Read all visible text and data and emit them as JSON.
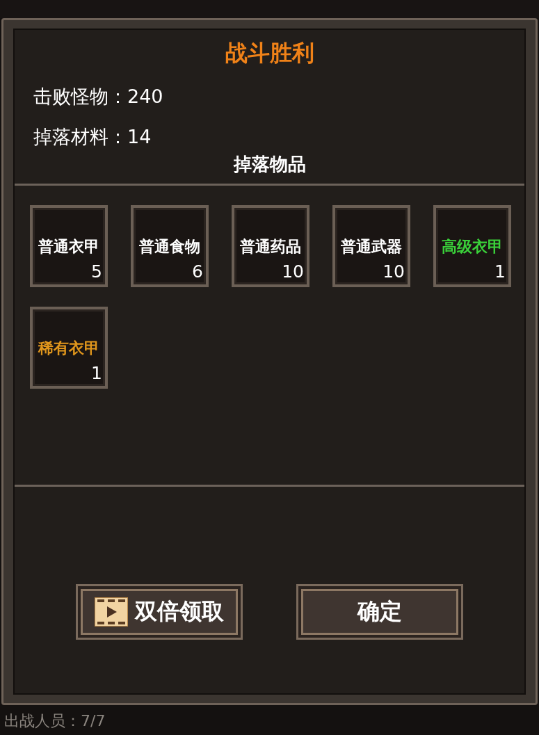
{
  "title": "战斗胜利",
  "stats": [
    {
      "label": "击败怪物：",
      "value": "240"
    },
    {
      "label": "掉落材料：",
      "value": "14"
    }
  ],
  "drops": {
    "heading": "掉落物品",
    "items": [
      {
        "name": "普通衣甲",
        "count": "5",
        "color": "#ffffff"
      },
      {
        "name": "普通食物",
        "count": "6",
        "color": "#ffffff"
      },
      {
        "name": "普通药品",
        "count": "10",
        "color": "#ffffff"
      },
      {
        "name": "普通武器",
        "count": "10",
        "color": "#ffffff"
      },
      {
        "name": "高级衣甲",
        "count": "1",
        "color": "#3ad13a"
      },
      {
        "name": "稀有衣甲",
        "count": "1",
        "color": "#e0961c"
      }
    ]
  },
  "buttons": [
    {
      "label": "双倍领取",
      "kind": "video"
    },
    {
      "label": "确定",
      "kind": "plain"
    }
  ],
  "footer": "出战人员：7/7"
}
